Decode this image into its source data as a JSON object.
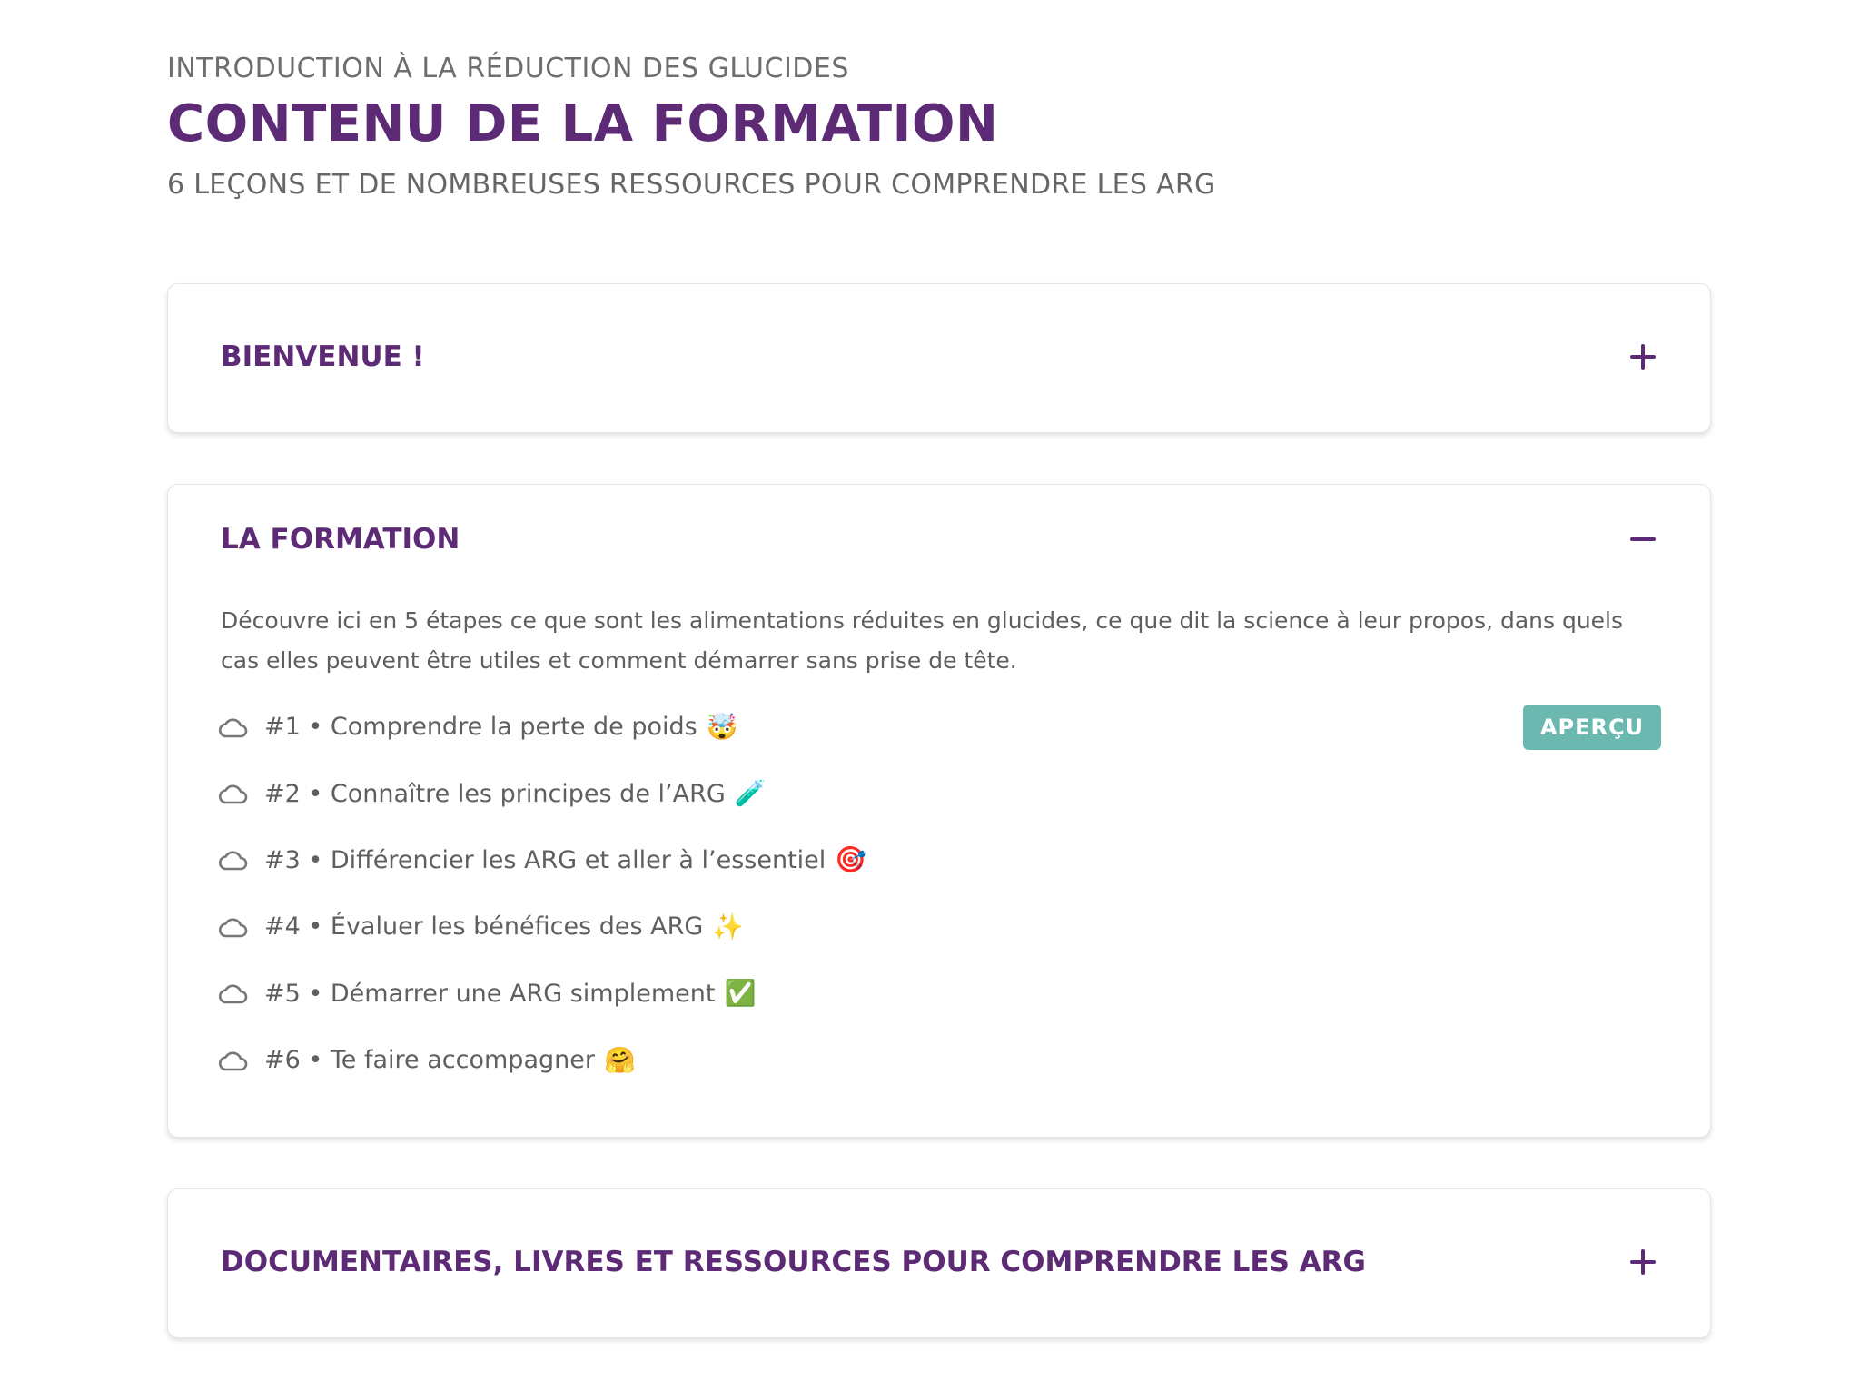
{
  "header": {
    "eyebrow": "INTRODUCTION À LA RÉDUCTION DES GLUCIDES",
    "title": "CONTENU DE LA FORMATION",
    "subtitle": "6 LEÇONS ET DE NOMBREUSES RESSOURCES POUR COMPRENDRE LES ARG"
  },
  "sections": [
    {
      "title": "BIENVENUE !",
      "state": "collapsed",
      "toggle_icon": "plus-icon"
    },
    {
      "title": "LA FORMATION",
      "state": "expanded",
      "toggle_icon": "minus-icon",
      "description": "Découvre ici en 5 étapes ce que sont les alimentations réduites en glucides, ce que dit la science à leur propos, dans quels cas elles peuvent être utiles et comment démarrer sans prise de tête.",
      "lessons": [
        {
          "label": "#1 • Comprendre la perte de poids",
          "emoji": "🤯",
          "icon": "cloud-icon",
          "preview_label": "APERÇU"
        },
        {
          "label": "#2 • Connaître les principes de l’ARG",
          "emoji": "🧪",
          "icon": "cloud-icon"
        },
        {
          "label": "#3 • Différencier les ARG et aller à l’essentiel",
          "emoji": "🎯",
          "icon": "cloud-icon"
        },
        {
          "label": "#4 • Évaluer les bénéfices des ARG",
          "emoji": "✨",
          "icon": "cloud-icon"
        },
        {
          "label": "#5 • Démarrer une ARG simplement",
          "emoji": "✅",
          "icon": "cloud-icon"
        },
        {
          "label": "#6 • Te faire accompagner",
          "emoji": "🤗",
          "icon": "cloud-icon"
        }
      ]
    },
    {
      "title": "DOCUMENTAIRES, LIVRES ET RESSOURCES POUR COMPRENDRE LES ARG",
      "state": "collapsed",
      "toggle_icon": "plus-icon"
    }
  ],
  "colors": {
    "brand_purple": "#5d2a76",
    "preview_teal": "#6bb8b0",
    "body_text": "#5f5f5f"
  }
}
